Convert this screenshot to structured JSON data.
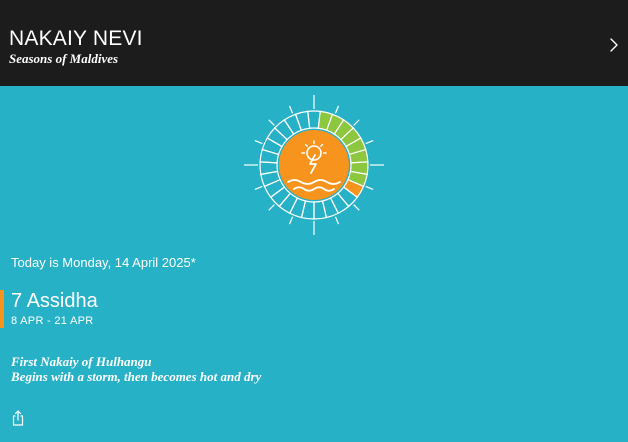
{
  "header": {
    "title": "NAKAIY NEVI",
    "subtitle": "Seasons of Maldives",
    "next_icon": "chevron-right-icon"
  },
  "colors": {
    "background": "#27b1c6",
    "header_bg": "#1c1c1c",
    "accent": "#f7941d",
    "sun": "#f7941d",
    "segment_green": "#8dc63f",
    "segment_orange": "#f7941d"
  },
  "emblem": {
    "icon": "sun-storm-sea-icon",
    "segments_total": 27,
    "highlight_green_count": 8,
    "highlight_orange_count": 1
  },
  "main": {
    "today_text": "Today is Monday, 14 April 2025*",
    "period_name": "7 Assidha",
    "period_range": "8 APR - 21 APR",
    "description_line1": "First Nakaiy of Hulhangu",
    "description_line2": "Begins with a storm, then becomes hot and dry"
  },
  "footer": {
    "share_icon": "share-icon"
  }
}
